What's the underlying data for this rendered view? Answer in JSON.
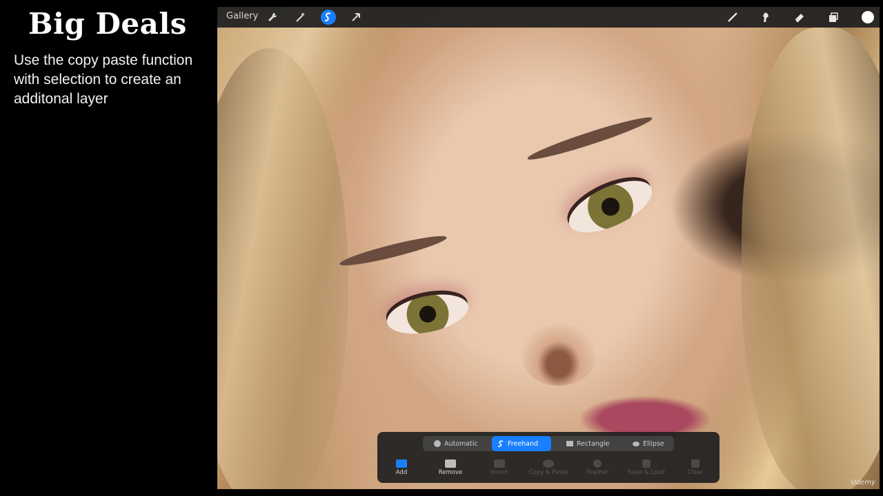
{
  "slide": {
    "title": "Big Deals",
    "body": "Use the copy paste function with selection to create an additonal layer"
  },
  "toolbar": {
    "gallery_label": "Gallery",
    "left_icons": [
      "wrench-icon",
      "magic-wand-icon",
      "selection-icon",
      "arrow-icon"
    ],
    "right_icons": [
      "brush-icon",
      "smudge-icon",
      "eraser-icon",
      "layers-icon",
      "color-icon"
    ],
    "accent": "#1a7fff"
  },
  "selection": {
    "modes": [
      {
        "label": "Automatic",
        "icon": "automatic-icon",
        "active": false
      },
      {
        "label": "Freehand",
        "icon": "freehand-icon",
        "active": true
      },
      {
        "label": "Rectangle",
        "icon": "rectangle-icon",
        "active": false
      },
      {
        "label": "Ellipse",
        "icon": "ellipse-icon",
        "active": false
      }
    ],
    "actions": [
      {
        "label": "Add",
        "icon": "add-icon",
        "enabled": true
      },
      {
        "label": "Remove",
        "icon": "remove-icon",
        "enabled": true
      },
      {
        "label": "Invert",
        "icon": "invert-icon",
        "enabled": false
      },
      {
        "label": "Copy & Paste",
        "icon": "copy-paste-icon",
        "enabled": false
      },
      {
        "label": "Feather",
        "icon": "feather-icon",
        "enabled": false
      },
      {
        "label": "Save & Load",
        "icon": "save-load-icon",
        "enabled": false
      },
      {
        "label": "Clear",
        "icon": "clear-icon",
        "enabled": false
      }
    ]
  },
  "watermark": "Udemy"
}
